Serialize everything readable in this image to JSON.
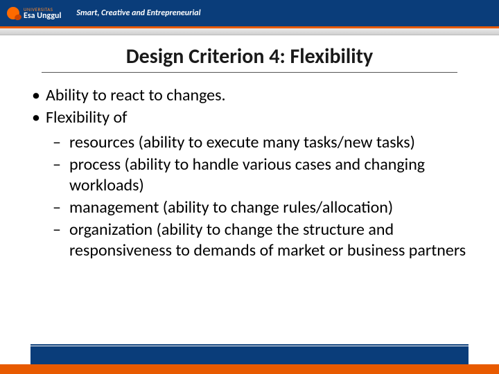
{
  "header": {
    "logo_small": "UNIVERSITAS",
    "logo_big": "Esa Unggul",
    "tagline": "Smart, Creative and Entrepreneurial"
  },
  "slide": {
    "title": "Design Criterion 4: Flexibility",
    "bullets": [
      "Ability to react to changes.",
      "Flexibility of"
    ],
    "sub": [
      "resources (ability to execute many tasks/new tasks)",
      "process (ability to handle various cases and changing workloads)",
      "management (ability to change rules/allocation)",
      "organization (ability to change the structure and responsiveness to demands of market or business partners"
    ]
  }
}
